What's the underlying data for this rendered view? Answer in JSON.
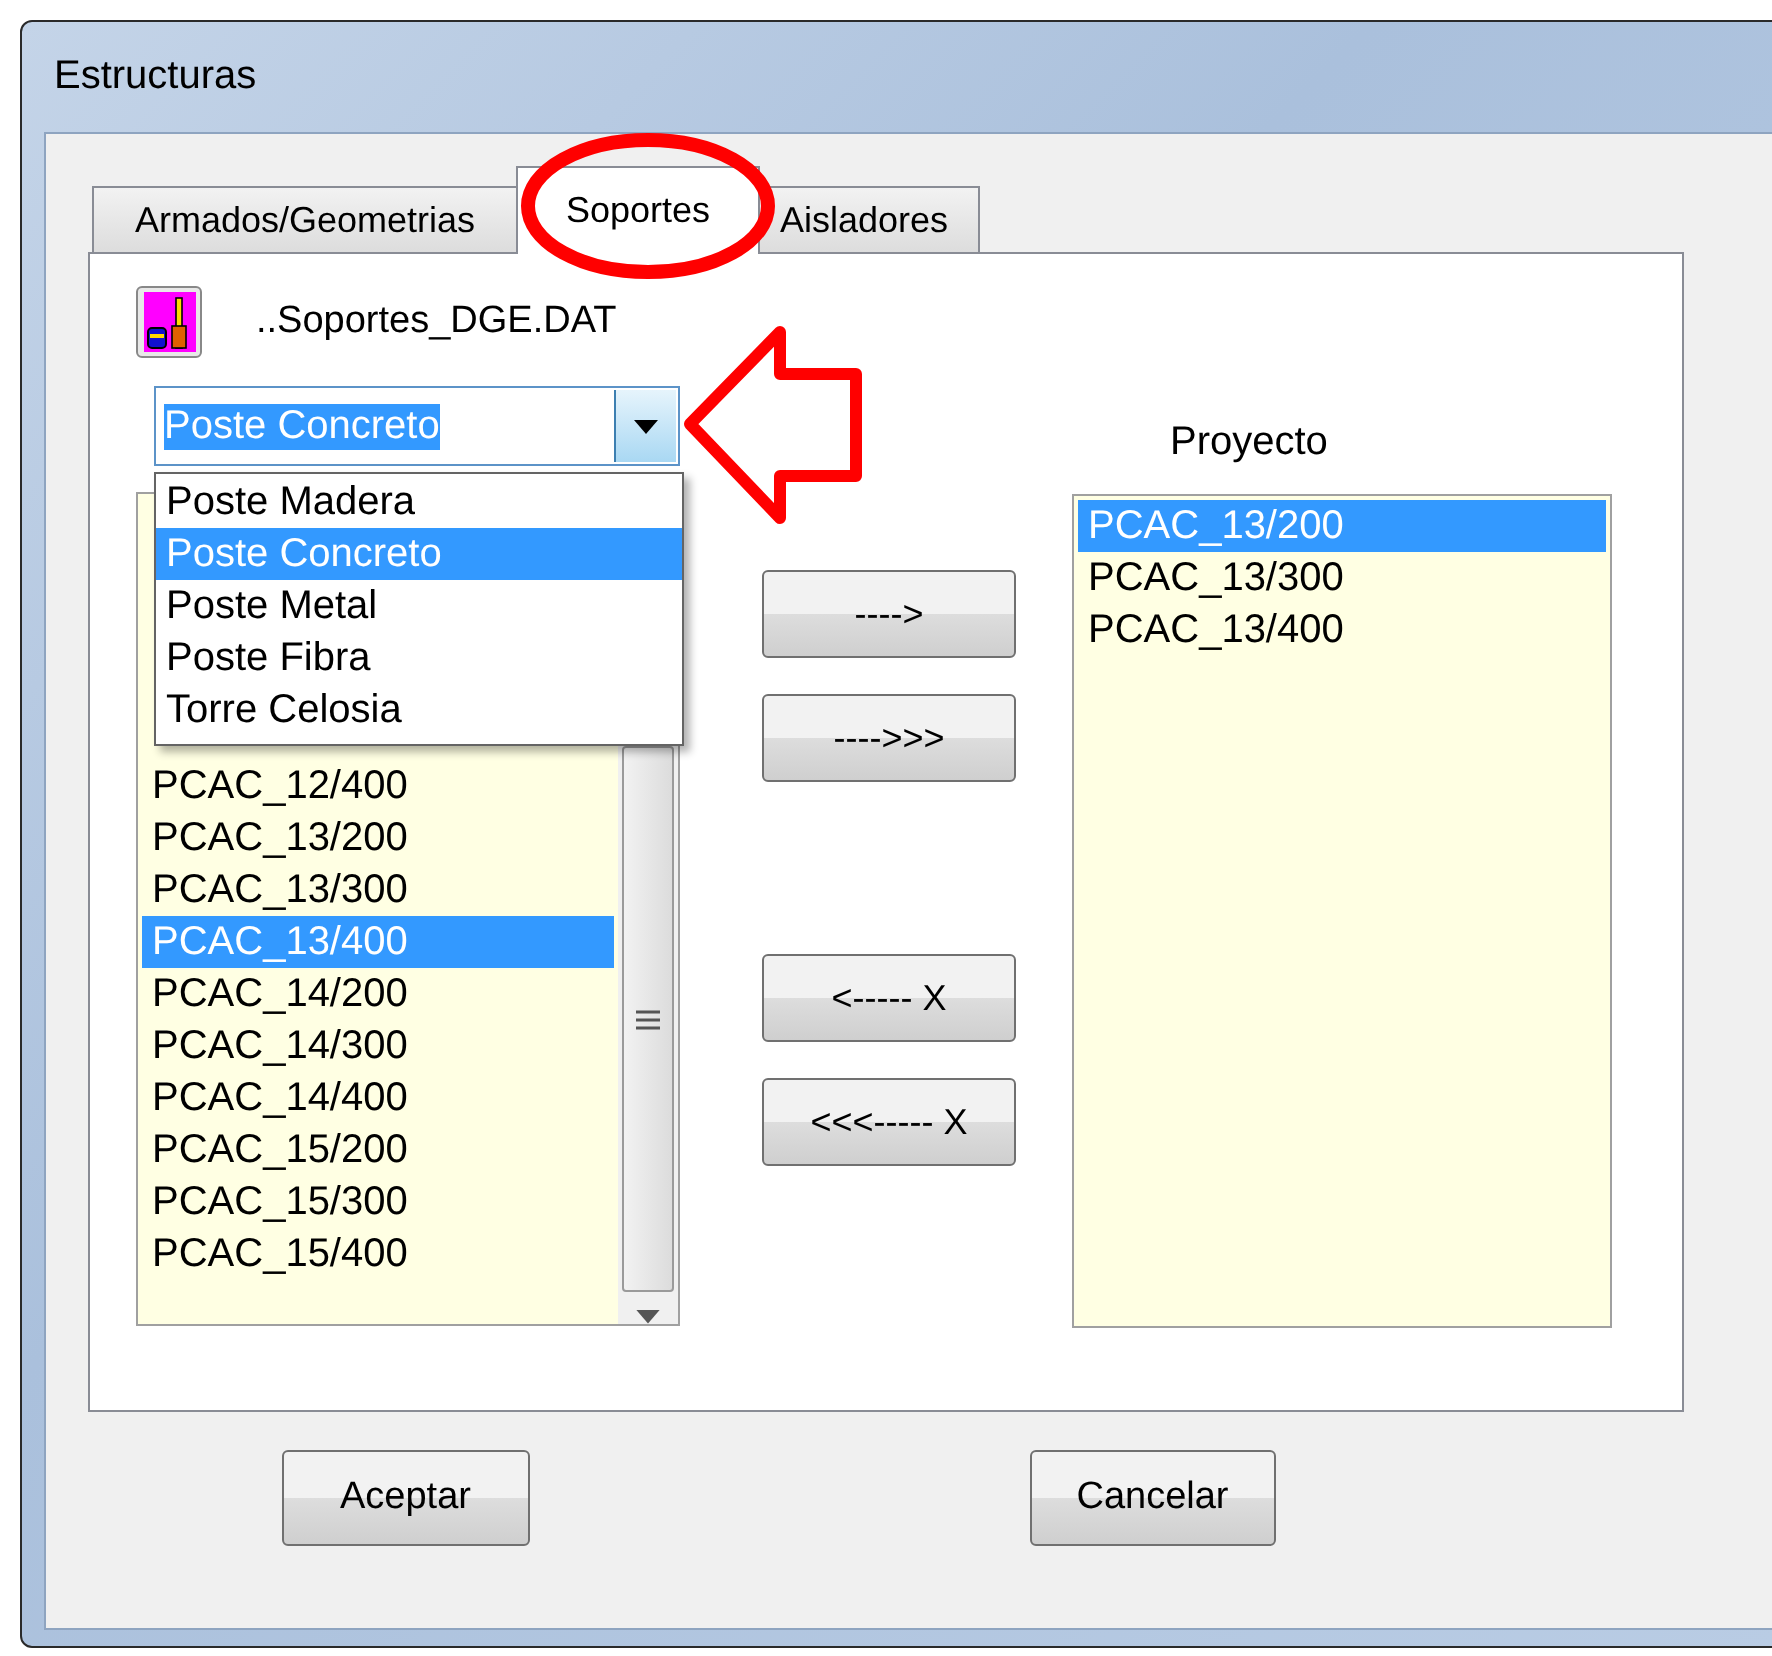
{
  "window": {
    "title": "Estructuras"
  },
  "tabs": [
    {
      "label": "Armados/Geometrias",
      "selected": false
    },
    {
      "label": "Soportes",
      "selected": true
    },
    {
      "label": "Aisladores",
      "selected": false
    }
  ],
  "file_label": "..Soportes_DGE.DAT",
  "combo": {
    "value": "Poste Concreto",
    "expanded": true,
    "options": [
      {
        "label": "Poste Madera",
        "selected": false
      },
      {
        "label": "Poste Concreto",
        "selected": true
      },
      {
        "label": "Poste Metal",
        "selected": false
      },
      {
        "label": "Poste Fibra",
        "selected": false
      },
      {
        "label": "Torre Celosia",
        "selected": false
      }
    ]
  },
  "available_list": [
    {
      "label": "PCAC_12/400",
      "selected": false
    },
    {
      "label": "PCAC_13/200",
      "selected": false
    },
    {
      "label": "PCAC_13/300",
      "selected": false
    },
    {
      "label": "PCAC_13/400",
      "selected": true
    },
    {
      "label": "PCAC_14/200",
      "selected": false
    },
    {
      "label": "PCAC_14/300",
      "selected": false
    },
    {
      "label": "PCAC_14/400",
      "selected": false
    },
    {
      "label": "PCAC_15/200",
      "selected": false
    },
    {
      "label": "PCAC_15/300",
      "selected": false
    },
    {
      "label": "PCAC_15/400",
      "selected": false
    }
  ],
  "transfer_buttons": [
    "---->",
    "---->>>",
    "<----- X",
    "<<<----- X"
  ],
  "project": {
    "label": "Proyecto",
    "items": [
      {
        "label": "PCAC_13/200",
        "selected": true
      },
      {
        "label": "PCAC_13/300",
        "selected": false
      },
      {
        "label": "PCAC_13/400",
        "selected": false
      }
    ]
  },
  "buttons": [
    "Aceptar",
    "Cancelar"
  ]
}
